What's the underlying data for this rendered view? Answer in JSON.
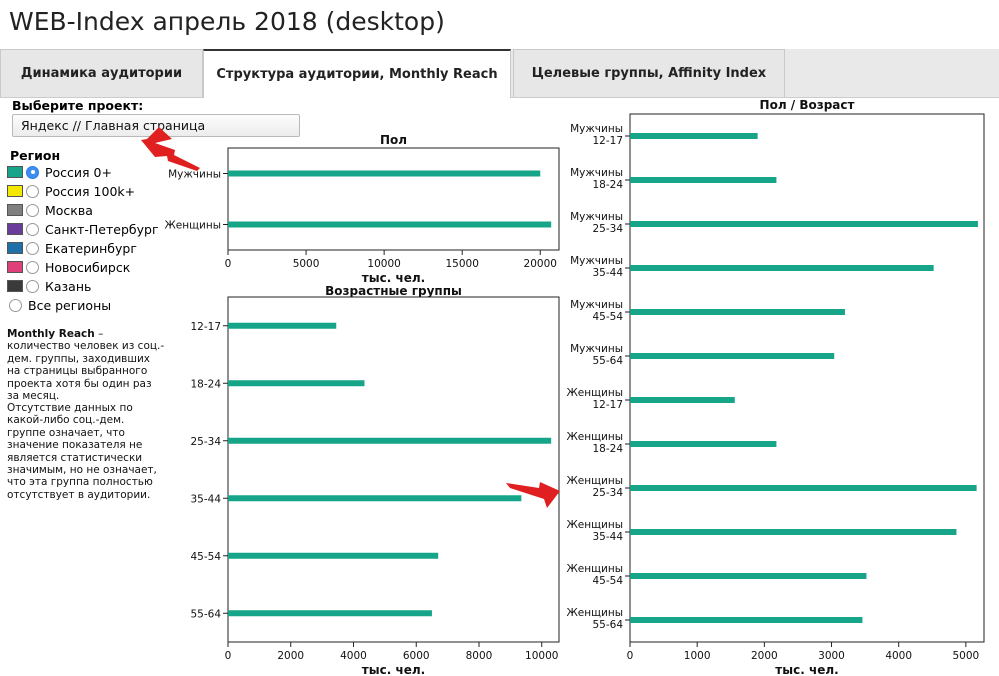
{
  "app": {
    "title": "WEB-Index апрель 2018 (desktop)"
  },
  "tabs": [
    {
      "label": "Динамика аудитории",
      "active": false
    },
    {
      "label": "Структура аудитории, Monthly Reach",
      "active": true
    },
    {
      "label": "Целевые группы, Affinity Index",
      "active": false
    }
  ],
  "project": {
    "label": "Выберите проект:",
    "selected": "Яндекс // Главная страница"
  },
  "region": {
    "label": "Регион",
    "items": [
      {
        "name": "Россия 0+",
        "color": "#17a589",
        "checked": true
      },
      {
        "name": "Россия 100k+",
        "color": "#f5e800",
        "checked": false
      },
      {
        "name": "Москва",
        "color": "#7f7f7f",
        "checked": false
      },
      {
        "name": "Санкт-Петербург",
        "color": "#6a3d9a",
        "checked": false
      },
      {
        "name": "Екатеринбург",
        "color": "#1f6fa8",
        "checked": false
      },
      {
        "name": "Новосибирск",
        "color": "#e0407a",
        "checked": false
      },
      {
        "name": "Казань",
        "color": "#3a3a3a",
        "checked": false
      },
      {
        "name": "Все регионы",
        "color": "",
        "checked": false
      }
    ]
  },
  "notes": {
    "reach_title": "Monthly Reach",
    "reach_text": " – количество человек из соц.-дем. группы, заходивших на страницы выбранного проекта хотя бы один раз за месяц.",
    "missing": "Отсутствие данных по какой-либо соц.-дем. группе означает, что значение показателя не является статистически значимым, но не означает, что эта группа полностью отсутствует в аудитории."
  },
  "colors": {
    "bar": "#17a589",
    "arrow": "#e02020"
  },
  "chart_data": [
    {
      "type": "bar",
      "orientation": "horizontal",
      "title": "Пол",
      "xlabel": "тыс. чел.",
      "categories": [
        "Мужчины",
        "Женщины"
      ],
      "values": [
        20000,
        20700
      ],
      "xlim": [
        0,
        21200
      ],
      "ticks": [
        0,
        5000,
        10000,
        15000,
        20000
      ],
      "grid": false
    },
    {
      "type": "bar",
      "orientation": "horizontal",
      "title": "Возрастные группы",
      "xlabel": "тыс. чел.",
      "categories": [
        "12-17",
        "18-24",
        "25-34",
        "35-44",
        "45-54",
        "55-64"
      ],
      "values": [
        3450,
        4350,
        10300,
        9350,
        6700,
        6500
      ],
      "xlim": [
        0,
        10550
      ],
      "ticks": [
        0,
        2000,
        4000,
        6000,
        8000,
        10000
      ],
      "grid": false
    },
    {
      "type": "bar",
      "orientation": "horizontal",
      "title": "Пол / Возраст",
      "xlabel": "тыс. чел.",
      "categories": [
        [
          "Мужчины",
          "12-17"
        ],
        [
          "Мужчины",
          "18-24"
        ],
        [
          "Мужчины",
          "25-34"
        ],
        [
          "Мужчины",
          "35-44"
        ],
        [
          "Мужчины",
          "45-54"
        ],
        [
          "Мужчины",
          "55-64"
        ],
        [
          "Женщины",
          "12-17"
        ],
        [
          "Женщины",
          "18-24"
        ],
        [
          "Женщины",
          "25-34"
        ],
        [
          "Женщины",
          "35-44"
        ],
        [
          "Женщины",
          "45-54"
        ],
        [
          "Женщины",
          "55-64"
        ]
      ],
      "values": [
        1900,
        2180,
        5180,
        4520,
        3200,
        3040,
        1560,
        2180,
        5160,
        4860,
        3520,
        3460
      ],
      "xlim": [
        0,
        5270
      ],
      "ticks": [
        0,
        1000,
        2000,
        3000,
        4000,
        5000
      ],
      "grid": false
    }
  ]
}
